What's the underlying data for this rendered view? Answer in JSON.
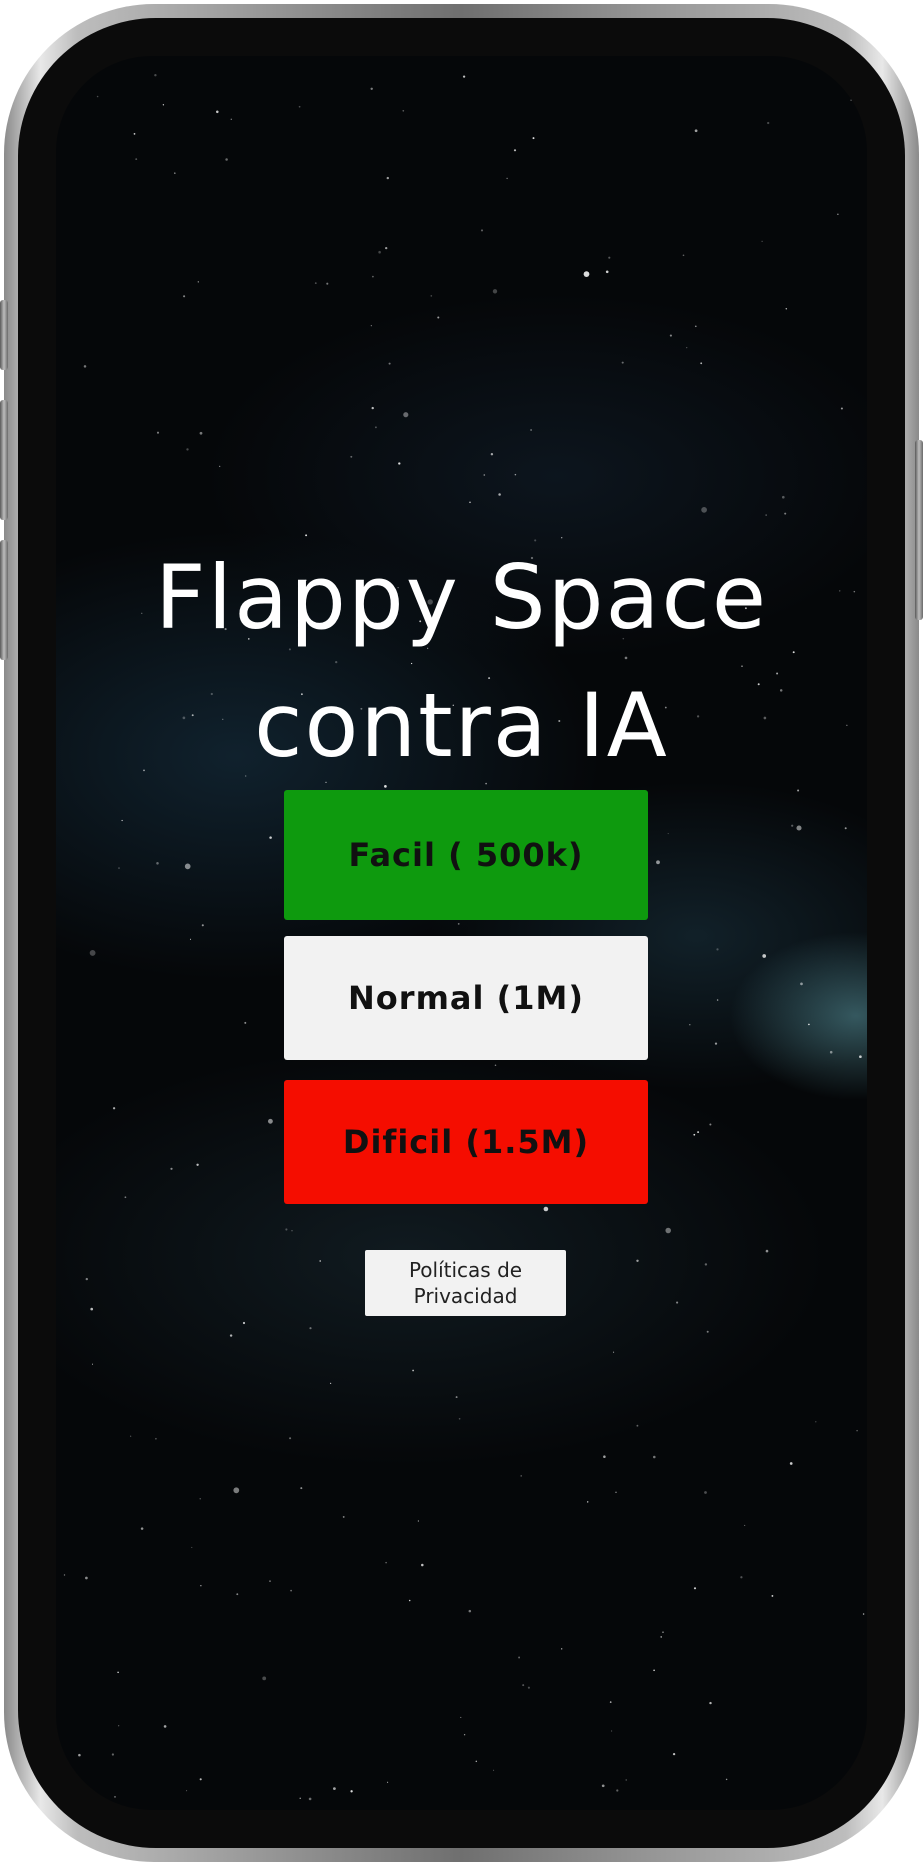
{
  "app": {
    "title_line1": "Flappy Space",
    "title_line2": "contra IA"
  },
  "menu": {
    "easy_label": "Facil ( 500k)",
    "normal_label": "Normal (1M)",
    "hard_label": "Dificil (1.5M)",
    "privacy_label": "Políticas de\nPrivacidad"
  },
  "colors": {
    "easy": "#0e9a0e",
    "normal": "#f2f2f2",
    "hard": "#f50d00",
    "background": "#050709"
  }
}
